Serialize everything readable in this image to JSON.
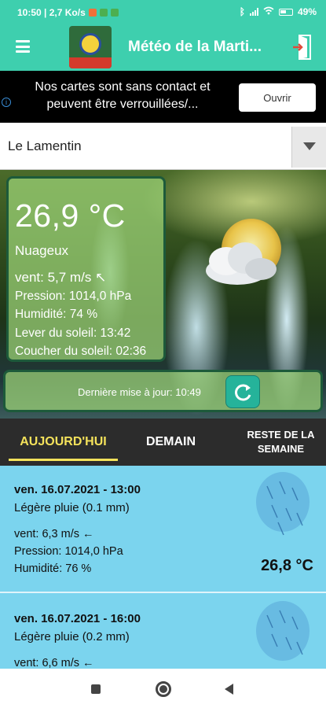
{
  "status_bar": {
    "time_speed": "10:50 | 2,7 Ko/s",
    "battery": "49%",
    "chip_colors": [
      "#f0703a",
      "#4caf50",
      "#4caf50"
    ]
  },
  "app_bar": {
    "title": "Météo de la Marti...",
    "menu_icon": "hamburger-menu-icon",
    "exit_icon": "exit-door-icon",
    "brand_color": "#3ecfae"
  },
  "ad": {
    "text": "Nos cartes sont sans contact et peuvent être verrouillées/...",
    "button": "Ouvrir",
    "info_icon": "ad-info-icon"
  },
  "location": {
    "value": "Le Lamentin"
  },
  "current": {
    "temperature": "26,9 °C",
    "condition": "Nuageux",
    "wind": "vent: 5,7 m/s ↖",
    "pressure": "Pression: 1014,0 hPa",
    "humidity": "Humidité: 74 %",
    "sunrise": "Lever du soleil: 13:42",
    "sunset": "Coucher du soleil: 02:36",
    "icon": "sun-behind-cloud-icon"
  },
  "update": {
    "text": "Dernière mise à jour: 10:49",
    "refresh_icon": "refresh-icon"
  },
  "tabs": {
    "today": "AUJOURD'HUI",
    "tomorrow": "DEMAIN",
    "rest_line1": "RESTE DE LA",
    "rest_line2": "SEMAINE",
    "active_color": "#f4e25b"
  },
  "forecasts": [
    {
      "date": "ven. 16.07.2021 - 13:00",
      "desc": "Légère pluie (0.1 mm)",
      "wind": "vent: 6,3 m/s ←",
      "pressure": "Pression: 1014,0 hPa",
      "humidity": "Humidité: 76 %",
      "temp": "26,8 °C",
      "icon": "rain-icon"
    },
    {
      "date": "ven. 16.07.2021 - 16:00",
      "desc": "Légère pluie (0.2 mm)",
      "wind": "vent: 6,6 m/s ←",
      "icon": "rain-icon"
    }
  ]
}
